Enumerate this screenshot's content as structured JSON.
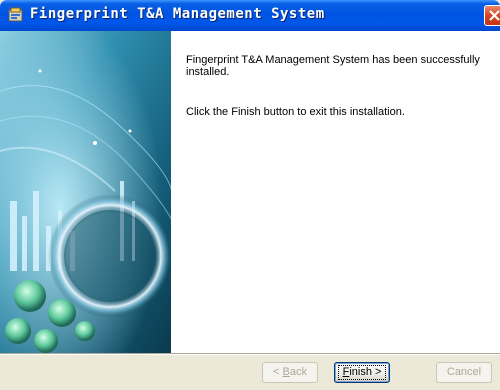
{
  "window": {
    "title": "Fingerprint T&A Management System"
  },
  "content": {
    "message_installed": "Fingerprint T&A Management System has been successfully installed.",
    "message_finish": "Click the Finish button to exit this installation."
  },
  "buttons": {
    "back_prefix": "< ",
    "back_underlined": "B",
    "back_rest": "ack",
    "finish_underlined": "F",
    "finish_rest": "inish >",
    "cancel": "Cancel"
  },
  "colors": {
    "titlebar": "#0054e3",
    "dialog_bg": "#ece9d8",
    "side_panel": "#1e6f8c"
  },
  "icons": {
    "app": "installer-app-icon",
    "close": "close-icon",
    "side": "fingerprint-tech-banner"
  }
}
